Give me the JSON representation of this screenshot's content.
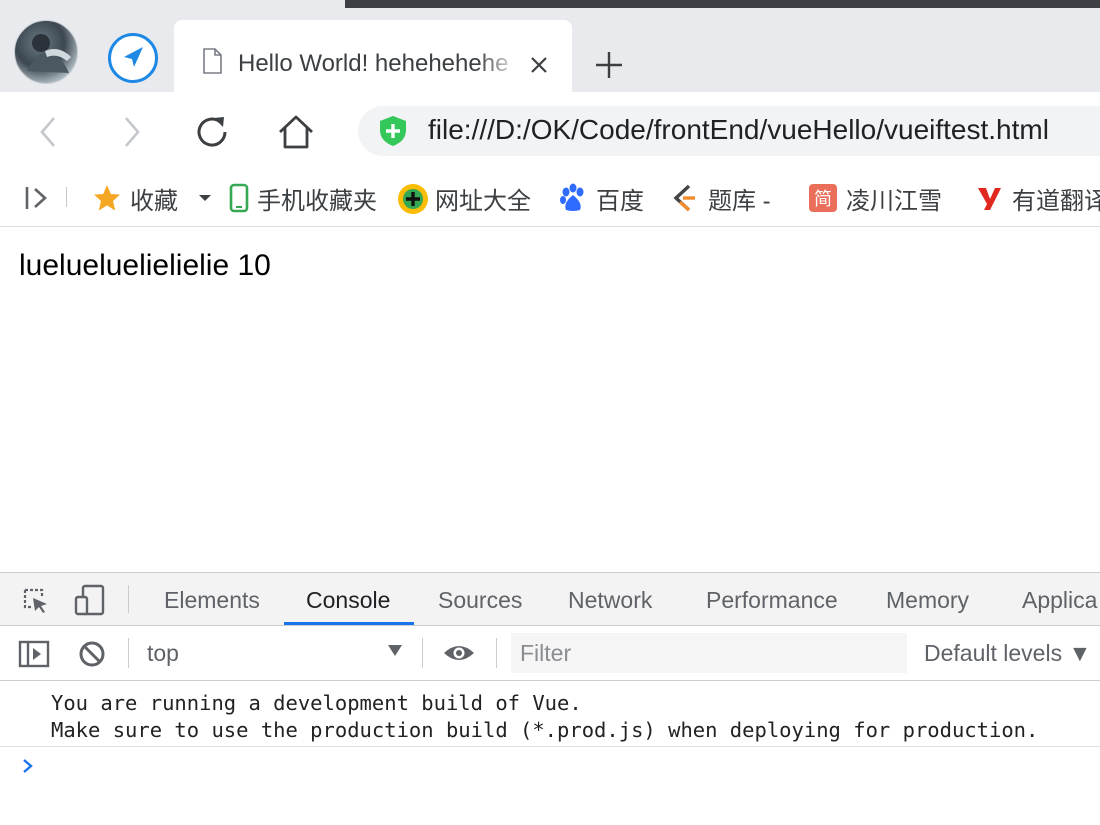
{
  "tab": {
    "title": "Hello World! hehehehehe",
    "favicon": "page-icon"
  },
  "toolbar": {
    "url": "file:///D:/OK/Code/frontEnd/vueHello/vueiftest.html"
  },
  "bookmarks": [
    {
      "label": "收藏",
      "icon": "star-icon",
      "color": "#f5a623"
    },
    {
      "label": "手机收藏夹",
      "icon": "phone-icon",
      "color": "#34a853"
    },
    {
      "label": "网址大全",
      "icon": "directory-icon",
      "color": "#fbbc05"
    },
    {
      "label": "百度",
      "icon": "baidu-paw-icon",
      "color": "#2f6bff"
    },
    {
      "label": "题库 -",
      "icon": "tiku-icon",
      "color": "#f28b2c"
    },
    {
      "label": "凌川江雪",
      "icon": "jianshu-icon",
      "color": "#ea6f5a"
    },
    {
      "label": "有道翻译",
      "icon": "youdao-icon",
      "color": "#e0281e"
    }
  ],
  "page": {
    "content": "luelueluelielielie 10"
  },
  "devtools": {
    "tabs": [
      "Elements",
      "Console",
      "Sources",
      "Network",
      "Performance",
      "Memory",
      "Applica"
    ],
    "active_tab": "Console",
    "context": "top",
    "filter_placeholder": "Filter",
    "levels": "Default levels ▼",
    "messages": [
      "You are running a development build of Vue.",
      "Make sure to use the production build (*.prod.js) when deploying for production."
    ]
  },
  "colors": {
    "accent": "#1a73e8",
    "shield": "#34c759"
  }
}
